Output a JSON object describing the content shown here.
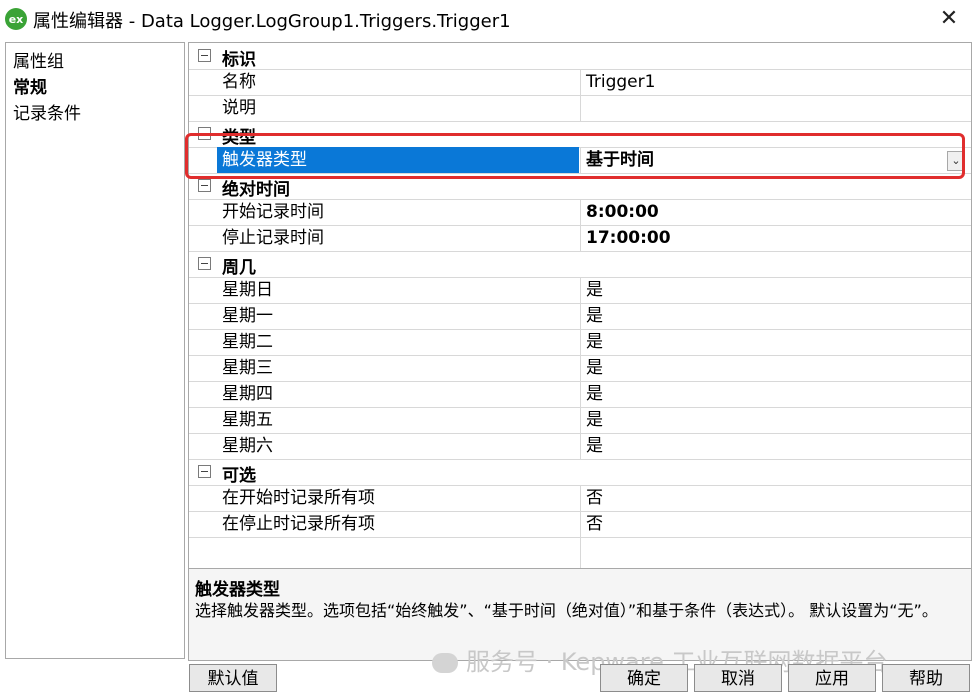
{
  "window": {
    "icon_label": "ex",
    "title": "属性编辑器 - Data Logger.LogGroup1.Triggers.Trigger1"
  },
  "sidebar": {
    "items": [
      {
        "label": "属性组"
      },
      {
        "label": "常规"
      },
      {
        "label": "记录条件"
      }
    ]
  },
  "properties": {
    "groups": {
      "g1": "标识",
      "g2": "类型",
      "g3": "绝对时间",
      "g4": "周几",
      "g5": "可选"
    },
    "rows": {
      "name": {
        "label": "名称",
        "value": "Trigger1"
      },
      "desc": {
        "label": "说明",
        "value": ""
      },
      "trigger_type": {
        "label": "触发器类型",
        "value": "基于时间"
      },
      "start_time": {
        "label": "开始记录时间",
        "value": "8:00:00"
      },
      "stop_time": {
        "label": "停止记录时间",
        "value": "17:00:00"
      },
      "sun": {
        "label": "星期日",
        "value": "是"
      },
      "mon": {
        "label": "星期一",
        "value": "是"
      },
      "tue": {
        "label": "星期二",
        "value": "是"
      },
      "wed": {
        "label": "星期三",
        "value": "是"
      },
      "thu": {
        "label": "星期四",
        "value": "是"
      },
      "fri": {
        "label": "星期五",
        "value": "是"
      },
      "sat": {
        "label": "星期六",
        "value": "是"
      },
      "log_all_start": {
        "label": "在开始时记录所有项",
        "value": "否"
      },
      "log_all_stop": {
        "label": "在停止时记录所有项",
        "value": "否"
      }
    }
  },
  "description": {
    "title": "触发器类型",
    "body": "选择触发器类型。选项包括“始终触发”、“基于时间（绝对值）”和基于条件（表达式）。 默认设置为“无”。"
  },
  "buttons": {
    "defaults": "默认值",
    "ok": "确定",
    "cancel": "取消",
    "apply": "应用",
    "help": "帮助"
  },
  "watermark": "服务号 · Kepware 工业互联网数据平台",
  "colors": {
    "selection": "#0a78d7",
    "highlight_box": "#e02d2d",
    "app_icon": "#3aa336"
  }
}
